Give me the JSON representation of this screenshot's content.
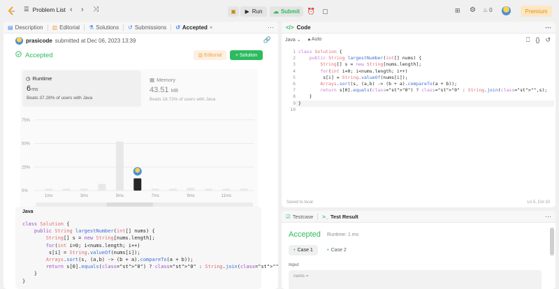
{
  "topbar": {
    "problem_list": "Problem List",
    "run": "Run",
    "submit": "Submit",
    "streak": "0",
    "premium": "Premium"
  },
  "left_tabs": [
    {
      "label": "Description"
    },
    {
      "label": "Editorial"
    },
    {
      "label": "Solutions"
    },
    {
      "label": "Submissions"
    },
    {
      "label": "Accepted"
    }
  ],
  "submission": {
    "user": "prasicode",
    "submitted_text": "submitted at Dec 06, 2023 13:39",
    "status": "Accepted",
    "editorial_btn": "Editorial",
    "solution_btn": "+ Solution"
  },
  "runtime": {
    "title": "Runtime",
    "value": "6",
    "unit": "ms",
    "beats": "Beats 37.28% of users with Java"
  },
  "memory": {
    "title": "Memory",
    "value": "43.51",
    "unit": "MB",
    "beats": "Beats 18.73% of users with Java"
  },
  "chart_data": {
    "type": "bar",
    "yticks": [
      "75%",
      "50%",
      "25%",
      "0%"
    ],
    "ylim": [
      0,
      80
    ],
    "categories": [
      "1ms",
      "",
      "3ms",
      "",
      "5ms",
      "",
      "7ms",
      "",
      "9ms",
      "",
      "11ms",
      ""
    ],
    "xtick_labels": [
      "1ms",
      "3ms",
      "5ms",
      "7ms",
      "9ms",
      "11ms"
    ],
    "values": [
      2,
      2,
      2,
      7,
      52,
      13,
      2,
      2,
      3,
      2,
      2,
      2
    ],
    "highlight_index": 5,
    "overview_labels": [
      "1ms",
      "3ms",
      "5ms",
      "7ms",
      "9ms",
      "11ms"
    ],
    "overview_values": [
      2,
      2,
      2,
      3,
      10,
      4,
      2,
      2,
      2,
      2,
      2,
      2
    ]
  },
  "code_preview": {
    "lang": "Java",
    "lines": [
      "class Solution {",
      "    public String largestNumber(int[] nums) {",
      "        String[] s = new String[nums.length];",
      "        for(int i=0; i<nums.length; i++)",
      "         s[i] = String.valueOf(nums[i]);",
      "        Arrays.sort(s, (a,b) -> (b + a).compareTo(a + b));",
      "        return s[0].equals(\"0\") ? \"0\" : String.join(\"\",s);",
      "    }",
      "}"
    ]
  },
  "code_panel": {
    "title": "Code",
    "language": "Java",
    "mode": "Auto",
    "saved": "Saved to local",
    "cursor": "Ln 5, Col 10",
    "line_numbers": [
      "1",
      "2",
      "3",
      "4",
      "5",
      "6",
      "7",
      "8",
      "9",
      "10"
    ],
    "lines": [
      "class Solution {",
      "    public String largestNumber(int[] nums) {",
      "        String[] s = new String[nums.length];",
      "        for(int i=0; i<nums.length; i++)",
      "         s[i] = String.valueOf(nums[i]);",
      "        Arrays.sort(s, (a,b) -> (b + a).compareTo(a + b));",
      "        return s[0].equals(\"0\") ? \"0\" : String.join(\"\",s);",
      "    }",
      "}",
      ""
    ]
  },
  "test_panel": {
    "tab_testcase": "Testcase",
    "tab_result": "Test Result",
    "status": "Accepted",
    "runtime": "Runtime: 1 ms",
    "case1": "Case 1",
    "case2": "Case 2",
    "input_label": "Input",
    "input_var": "nums ="
  }
}
